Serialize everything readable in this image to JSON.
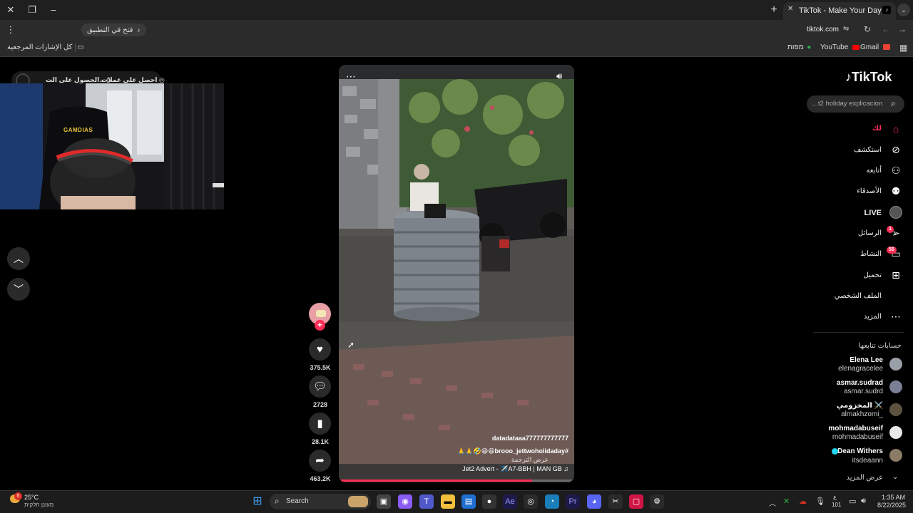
{
  "browser": {
    "tab_title": "TikTok - Make Your Day",
    "url": "tiktok.com",
    "open_in_app": "فتح في التطبيق",
    "profile_initial": "K",
    "bookmarks": {
      "all_bookmarks": "كل الإشارات المرجعية",
      "gmail": "Gmail",
      "youtube": "YouTube",
      "maps": "מפות"
    }
  },
  "overlay": {
    "get_coins": "احصل على عملات",
    "get_app": "الحصول على الت..."
  },
  "video": {
    "username": "datadataaa777777777777",
    "caption": "🙏🙏🤣😆😆brooo_jettwoholidaday#",
    "translate": "عرض الترجمة",
    "music": "Jet2 Advert - ✈️A7-BBH | MAN GB ♫",
    "more_icon": "ellipsis-icon",
    "sound_icon": "speaker-icon",
    "progress": 0.82
  },
  "actions": {
    "likes": "375.5K",
    "comments": "2728",
    "saves": "28.1K",
    "shares": "463.2K"
  },
  "sidebar": {
    "logo": "TikTok",
    "search_placeholder": "...t2 holiday explicacion",
    "nav": [
      {
        "label": "لك"
      },
      {
        "label": "استكشف"
      },
      {
        "label": "أتابعه"
      },
      {
        "label": "الأصدقاء"
      },
      {
        "label": "LIVE"
      },
      {
        "label": "الرسائل",
        "badge": "1"
      },
      {
        "label": "النشاط",
        "badge": "55"
      },
      {
        "label": "تحميل"
      },
      {
        "label": "الملف الشخصي"
      },
      {
        "label": "المزيد"
      }
    ],
    "following_title": "حسابات تتابعها",
    "accounts": [
      {
        "name": "Elena Lee",
        "handle": "elenagracelee"
      },
      {
        "name": "asmar.sudrad",
        "handle": "asmar.sudrd"
      },
      {
        "name": "المخزومي ⚔️",
        "handle": "almakhzomi_"
      },
      {
        "name": "mohmadabuseif",
        "handle": "mohmadabuseif"
      },
      {
        "name": "Dean Withers",
        "handle": "itsdeaann"
      }
    ],
    "show_more": "عرض المزيد"
  },
  "taskbar": {
    "weather_temp": "25°C",
    "weather_text": "מעונן חלקית",
    "weather_badge": "5",
    "search_label": "Search",
    "time": "1:35 AM",
    "date": "8/22/2025",
    "lang": "ع",
    "lang_code": "101"
  },
  "webcam": {
    "chair_brand": "GAMDIAS"
  },
  "colors": {
    "accent": "#fe2c55",
    "background": "#000000",
    "chrome_dark": "#1f1f1f"
  }
}
